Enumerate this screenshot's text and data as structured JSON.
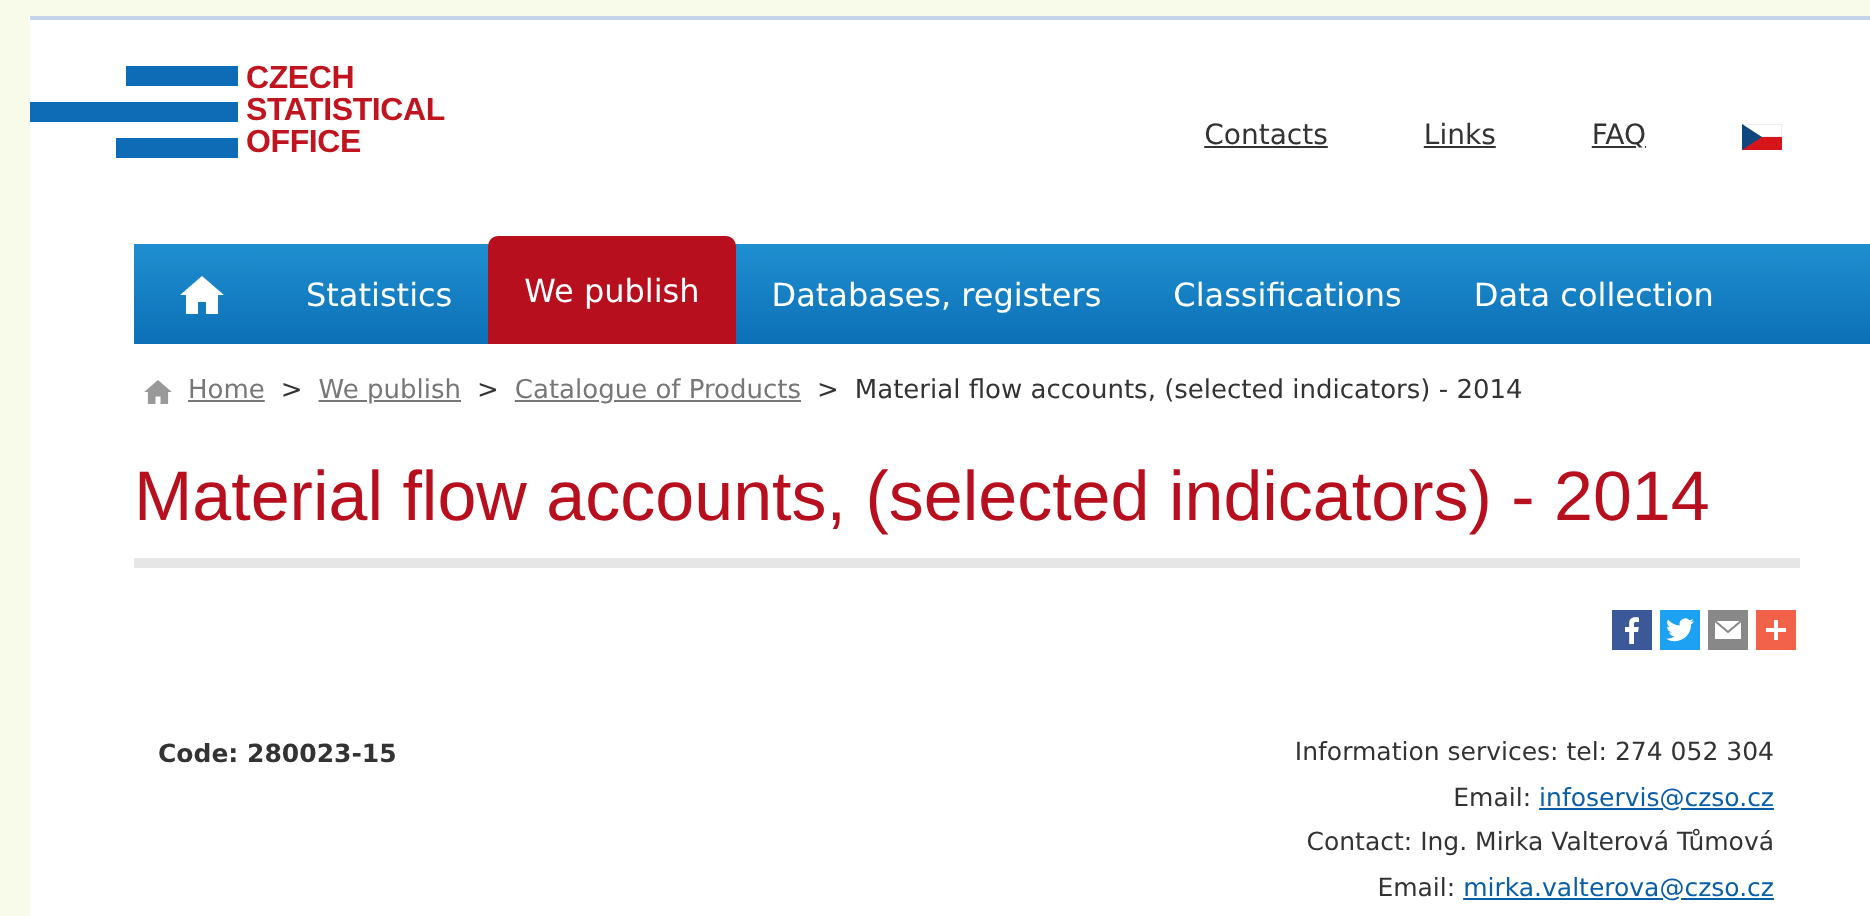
{
  "logo": {
    "lines": [
      "CZECH",
      "STATISTICAL",
      "OFFICE"
    ]
  },
  "top_links": [
    "Contacts",
    "Links",
    "FAQ"
  ],
  "nav": {
    "tabs": [
      {
        "label": "Statistics",
        "selected": false
      },
      {
        "label": "We publish",
        "selected": true
      },
      {
        "label": "Databases, registers",
        "selected": false
      },
      {
        "label": "Classifications",
        "selected": false
      },
      {
        "label": "Data collection",
        "selected": false
      }
    ]
  },
  "breadcrumb": {
    "links": [
      {
        "label": "Home"
      },
      {
        "separator": ">",
        "label": "We publish"
      },
      {
        "separator": ">",
        "label": "Catalogue of Products"
      }
    ],
    "current": {
      "separator": ">",
      "label": "Material flow accounts, (selected indicators) - 2014"
    }
  },
  "title": "Material flow accounts, (selected indicators) - 2014",
  "share": [
    {
      "kind": "facebook"
    },
    {
      "kind": "twitter"
    },
    {
      "kind": "email"
    },
    {
      "kind": "more"
    }
  ],
  "code": "Code: 280023-15",
  "contact": [
    {
      "label": "Information services: tel: 274 052 304"
    },
    {
      "label": "Email:",
      "link": "infoservis@czso.cz"
    },
    {
      "label": "Contact: Ing. Mirka Valterová Tůmová"
    },
    {
      "label": "Email:",
      "link": "mirka.valterova@czso.cz"
    }
  ]
}
